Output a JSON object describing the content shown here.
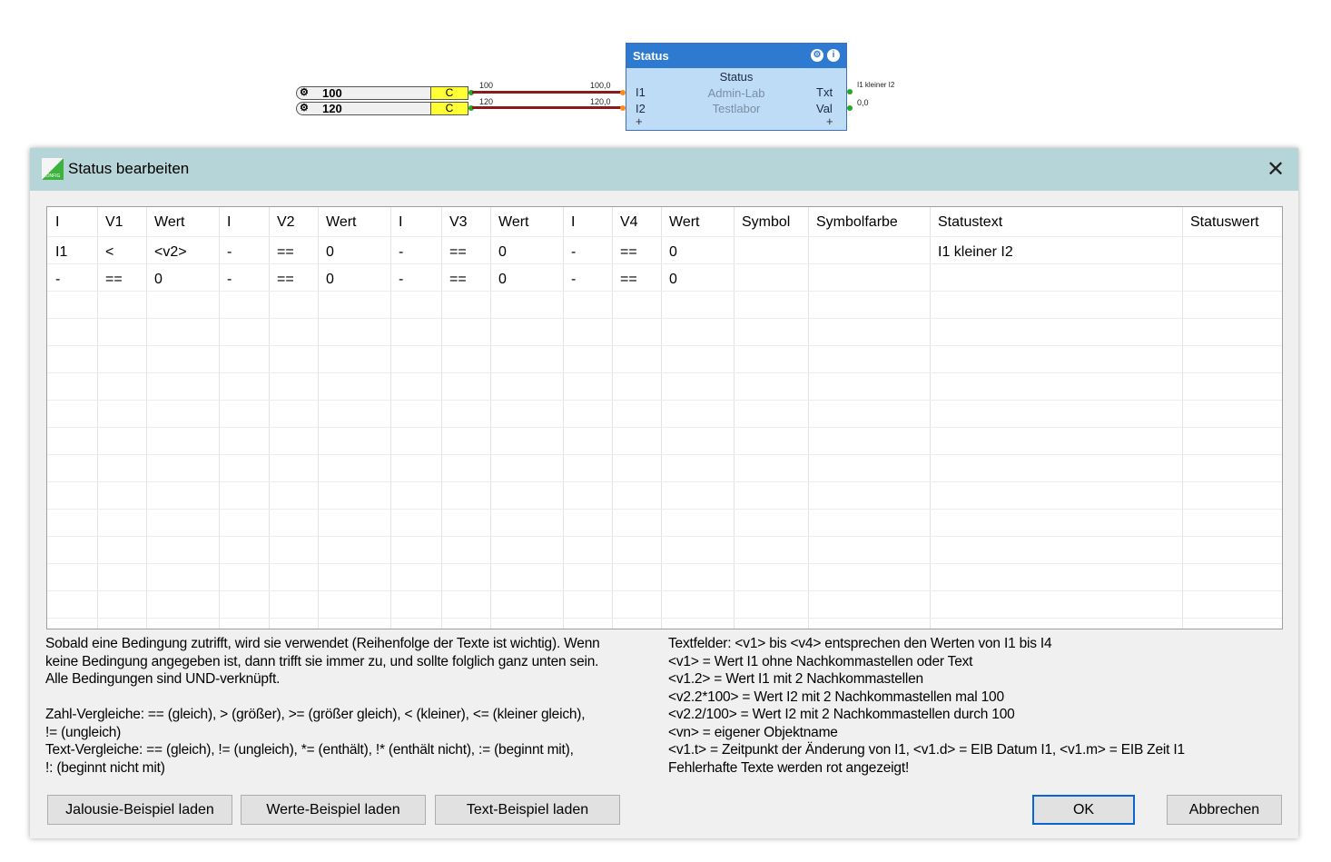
{
  "canvas": {
    "inputs": [
      {
        "value": "100",
        "type": "C",
        "wire_value": "100",
        "pin_value": "100,0"
      },
      {
        "value": "120",
        "type": "C",
        "wire_value": "120",
        "pin_value": "120,0"
      }
    ],
    "block": {
      "title": "Status",
      "line1": "Status",
      "line2": "Admin-Lab",
      "line3": "Testlabor",
      "in1": "I1",
      "in2": "I2",
      "out1": "Txt",
      "out2": "Val",
      "out1_value": "I1 kleiner I2",
      "out2_value": "0,0"
    }
  },
  "dialog": {
    "title": "Status bearbeiten",
    "table": {
      "headers": [
        "I",
        "V1",
        "Wert",
        "I",
        "V2",
        "Wert",
        "I",
        "V3",
        "Wert",
        "I",
        "V4",
        "Wert",
        "Symbol",
        "Symbolfarbe",
        "Statustext",
        "Statuswert"
      ],
      "rows": [
        [
          "I1",
          "<",
          "<v2>",
          "-",
          "==",
          "0",
          "-",
          "==",
          "0",
          "-",
          "==",
          "0",
          "",
          "",
          "I1 kleiner I2",
          ""
        ],
        [
          "-",
          "==",
          "0",
          "-",
          "==",
          "0",
          "-",
          "==",
          "0",
          "-",
          "==",
          "0",
          "",
          "",
          "",
          ""
        ]
      ]
    },
    "help_left": "Sobald eine Bedingung zutrifft, wird sie verwendet (Reihenfolge der Texte ist wichtig). Wenn\nkeine Bedingung angegeben ist, dann trifft sie immer zu, und sollte folglich ganz unten sein.\nAlle Bedingungen sind UND-verknüpft.\n\nZahl-Vergleiche: == (gleich), > (größer), >= (größer gleich), < (kleiner), <= (kleiner gleich),\n!= (ungleich)\nText-Vergleiche: == (gleich), != (ungleich), *= (enthält), !* (enthält nicht), := (beginnt mit),\n!: (beginnt nicht mit)",
    "help_right": "Textfelder: <v1> bis <v4> entsprechen den Werten von I1 bis I4\n<v1> = Wert I1 ohne Nachkommastellen oder Text\n<v1.2> = Wert I1 mit 2 Nachkommastellen\n<v2.2*100> = Wert I2 mit 2 Nachkommastellen mal 100\n<v2.2/100> = Wert I2 mit 2 Nachkommastellen durch 100\n<vn> = eigener Objektname\n<v1.t> = Zeitpunkt der Änderung von I1, <v1.d> = EIB Datum I1, <v1.m> = EIB Zeit I1\nFehlerhafte Texte werden rot angezeigt!",
    "buttons": {
      "jalousie": "Jalousie-Beispiel laden",
      "werte": "Werte-Beispiel laden",
      "text": "Text-Beispiel laden",
      "ok": "OK",
      "cancel": "Abbrechen"
    }
  }
}
